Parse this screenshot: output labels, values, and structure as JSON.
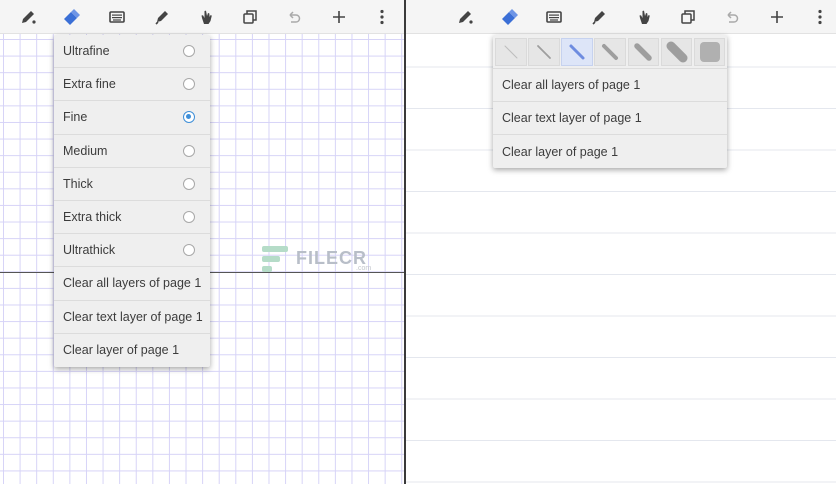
{
  "toolbar_icons": [
    "pen-icon",
    "eraser-icon",
    "keyboard-icon",
    "marker-icon",
    "hand-icon",
    "copy-icon",
    "undo-icon",
    "add-icon",
    "more-vertical-icon"
  ],
  "left_pane": {
    "thickness_menu": {
      "items": [
        {
          "label": "Ultrafine",
          "selected": false
        },
        {
          "label": "Extra fine",
          "selected": false
        },
        {
          "label": "Fine",
          "selected": true
        },
        {
          "label": "Medium",
          "selected": false
        },
        {
          "label": "Thick",
          "selected": false
        },
        {
          "label": "Extra thick",
          "selected": false
        },
        {
          "label": "Ultrathick",
          "selected": false
        }
      ],
      "clear_all_layers": "Clear all layers of page 1",
      "clear_text_layer": "Clear text layer of page 1",
      "clear_layer": "Clear layer of page 1"
    }
  },
  "right_pane": {
    "eraser_menu": {
      "size_options": 7,
      "selected_size_index": 2,
      "clear_all_layers": "Clear all layers of page 1",
      "clear_text_layer": "Clear text layer of page 1",
      "clear_layer": "Clear layer of page 1"
    }
  },
  "watermark": {
    "text": "FILECR",
    "suffix": ".com"
  },
  "colors": {
    "accent": "#3f8fd8",
    "active_tool": "#3b6fd6",
    "grid": "#d6d3f7",
    "toolbar_bg": "#f5f5f5",
    "menu_bg": "#efefef"
  }
}
